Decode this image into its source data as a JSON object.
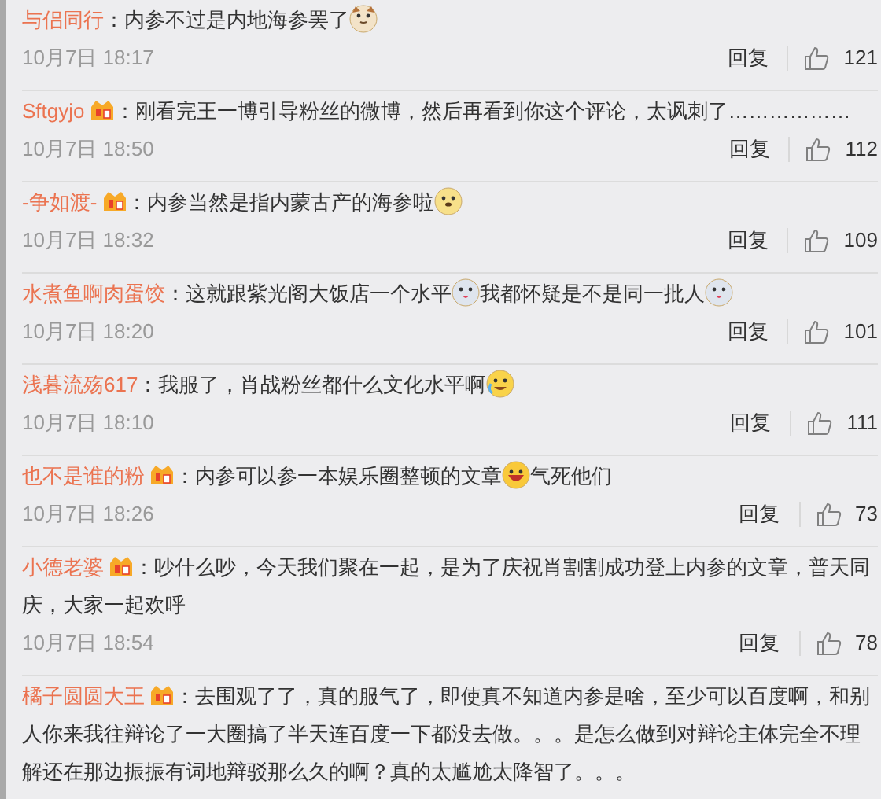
{
  "comments": [
    {
      "user": "与侣同行",
      "badge": false,
      "content": [
        {
          "kind": "text",
          "text": "：内参不过是内地海参罢了"
        },
        {
          "kind": "emoji"
        }
      ],
      "time": "10月7日 18:17",
      "reply": "回复",
      "likes": "121"
    },
    {
      "user": "Sftgyjo",
      "badge": true,
      "content": [
        {
          "kind": "text",
          "text": "：刚看完王一博引导粉丝的微博，然后再看到你这个评论，太讽刺了………………"
        }
      ],
      "time": "10月7日 18:50",
      "reply": "回复",
      "likes": "112"
    },
    {
      "user": "-争如渡-",
      "badge": true,
      "content": [
        {
          "kind": "text",
          "text": "：内参当然是指内蒙古产的海参啦"
        },
        {
          "kind": "emoji"
        }
      ],
      "time": "10月7日 18:32",
      "reply": "回复",
      "likes": "109"
    },
    {
      "user": "水煮鱼啊肉蛋饺",
      "badge": false,
      "content": [
        {
          "kind": "text",
          "text": "：这就跟紫光阁大饭店一个水平"
        },
        {
          "kind": "emoji"
        },
        {
          "kind": "text",
          "text": "我都怀疑是不是同一批人"
        },
        {
          "kind": "emoji"
        }
      ],
      "time": "10月7日 18:20",
      "reply": "回复",
      "likes": "101"
    },
    {
      "user": "浅暮流殇617",
      "badge": false,
      "content": [
        {
          "kind": "text",
          "text": "：我服了，肖战粉丝都什么文化水平啊"
        },
        {
          "kind": "emoji"
        }
      ],
      "time": "10月7日 18:10",
      "reply": "回复",
      "likes": "111"
    },
    {
      "user": "也不是谁的粉",
      "badge": true,
      "content": [
        {
          "kind": "text",
          "text": "：内参可以参一本娱乐圈整顿的文章"
        },
        {
          "kind": "emoji"
        },
        {
          "kind": "text",
          "text": "气死他们"
        }
      ],
      "time": "10月7日 18:26",
      "reply": "回复",
      "likes": "73"
    },
    {
      "user": "小德老婆",
      "badge": true,
      "content": [
        {
          "kind": "text",
          "text": "：吵什么吵，今天我们聚在一起，是为了庆祝肖割割成功登上内参的文章，普天同庆，大家一起欢呼"
        }
      ],
      "time": "10月7日 18:54",
      "reply": "回复",
      "likes": "78"
    },
    {
      "user": "橘子圆圆大王",
      "badge": true,
      "content": [
        {
          "kind": "text",
          "text": "：去围观了了，真的服气了，即使真不知道内参是啥，至少可以百度啊，和别人你来我往辩论了一大圈搞了半天连百度一下都没去做。。。是怎么做到对辩论主体完全不理解还在那边振振有词地辩驳那么久的啊？真的太尴尬太降智了。。。"
        }
      ]
    }
  ]
}
